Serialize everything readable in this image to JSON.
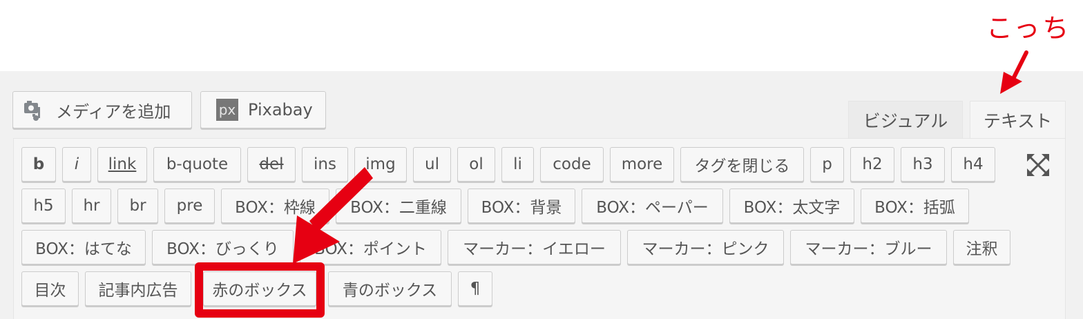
{
  "annotation": {
    "text": "こっち",
    "color": "#e60012"
  },
  "media_buttons": [
    {
      "label": "メディアを追加",
      "icon": "add-media-icon"
    },
    {
      "label": "Pixabay",
      "icon": "pixabay-icon",
      "icon_text": "px"
    }
  ],
  "tabs": [
    {
      "label": "ビジュアル",
      "active": false
    },
    {
      "label": "テキスト",
      "active": true
    }
  ],
  "quicktags": [
    [
      "b",
      "i",
      "link",
      "b-quote",
      "del",
      "ins",
      "img",
      "ul",
      "ol",
      "li",
      "code",
      "more",
      "タグを閉じる",
      "p",
      "h2",
      "h3",
      "h4"
    ],
    [
      "h5",
      "hr",
      "br",
      "pre",
      "BOX：枠線",
      "BOX：二重線",
      "BOX：背景",
      "BOX：ペーパー",
      "BOX：太文字",
      "BOX：括弧"
    ],
    [
      "BOX：はてな",
      "BOX：びっくり",
      "BOX：ポイント",
      "マーカー：イエロー",
      "マーカー：ピンク",
      "マーカー：ブルー",
      "注釈"
    ],
    [
      "目次",
      "記事内広告",
      "赤のボックス",
      "青のボックス",
      "¶"
    ]
  ],
  "fullscreen_icon": "expand-icon",
  "highlighted_button": "赤のボックス"
}
